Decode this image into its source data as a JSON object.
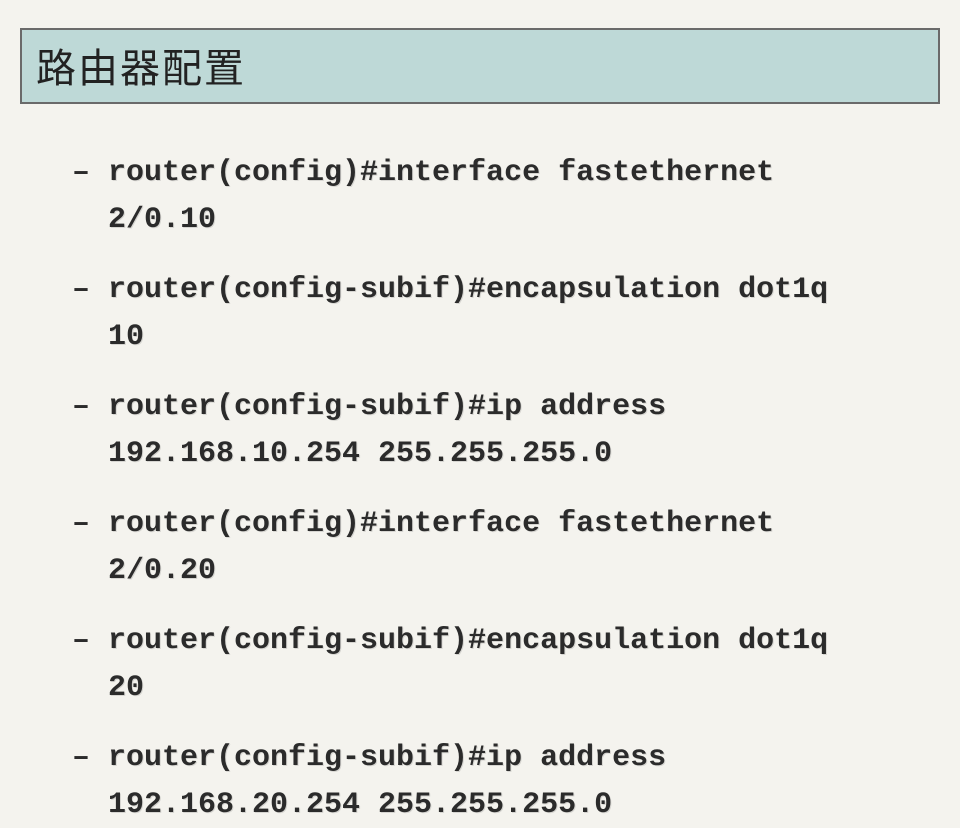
{
  "title": "路由器配置",
  "dash": "–",
  "commands": [
    "router(config)#interface fastethernet 2/0.10",
    "router(config-subif)#encapsulation dot1q 10",
    "router(config-subif)#ip address 192.168.10.254 255.255.255.0",
    "router(config)#interface fastethernet 2/0.20",
    "router(config-subif)#encapsulation  dot1q 20",
    "router(config-subif)#ip address 192.168.20.254 255.255.255.0"
  ]
}
